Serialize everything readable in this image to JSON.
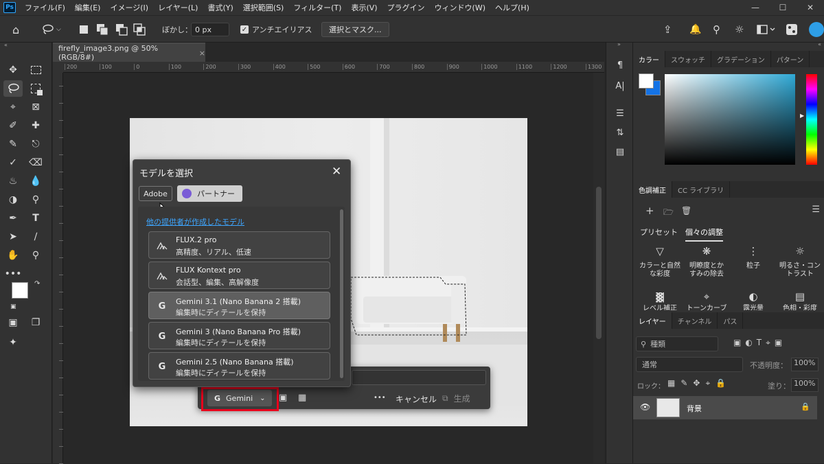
{
  "menubar": {
    "logo": "Ps",
    "items": [
      "ファイル(F)",
      "編集(E)",
      "イメージ(I)",
      "レイヤー(L)",
      "書式(Y)",
      "選択範囲(S)",
      "フィルター(T)",
      "表示(V)",
      "プラグイン",
      "ウィンドウ(W)",
      "ヘルプ(H)"
    ]
  },
  "options": {
    "feather_label": "ぼかし：",
    "feather_value": "0 px",
    "antialias_label": "アンチエイリアス",
    "select_mask": "選択とマスク..."
  },
  "document": {
    "tab_title": "firefly_image3.png @ 50% (RGB/8#)",
    "ruler_ticks": [
      "200",
      "100",
      "0",
      "100",
      "200",
      "300",
      "400",
      "500",
      "600",
      "700",
      "800",
      "900",
      "1000",
      "1100",
      "1200",
      "1300"
    ]
  },
  "dialog": {
    "title": "モデルを選択",
    "tab_adobe": "Adobe",
    "tab_partner": "パートナー",
    "section_link": "他の提供者が作成したモデル",
    "models": [
      {
        "name": "FLUX.2 pro",
        "desc": "高精度、リアル、低速",
        "icon": "flux-icon"
      },
      {
        "name": "FLUX Kontext pro",
        "desc": "会話型、編集、高解像度",
        "icon": "flux-icon"
      },
      {
        "name": "Gemini 3.1 (Nano Banana 2 搭載)",
        "desc": "編集時にディテールを保持",
        "icon": "google-icon",
        "selected": true
      },
      {
        "name": "Gemini 3 (Nano Banana Pro 搭載)",
        "desc": "編集時にディテールを保持",
        "icon": "google-icon"
      },
      {
        "name": "Gemini 2.5 (Nano Banana 搭載)",
        "desc": "編集時にディテールを保持",
        "icon": "google-icon"
      }
    ]
  },
  "genbar": {
    "model_label": "Gemini",
    "more": "•••",
    "cancel": "キャンセル",
    "generate": "生成"
  },
  "color_panel": {
    "tabs": [
      "カラー",
      "スウォッチ",
      "グラデーション",
      "パターン"
    ],
    "fg_color": "#ffffff",
    "bg_color": "#1473e6"
  },
  "adjust_panel": {
    "tabs": [
      "色調補正",
      "CC ライブラリ"
    ],
    "subtabs": [
      "プリセット",
      "個々の調整"
    ],
    "items": [
      {
        "label": "カラーと自然\nな彩度"
      },
      {
        "label": "明瞭度とか\nすみの除去"
      },
      {
        "label": "粒子"
      },
      {
        "label": "明るさ・コン\nトラスト"
      }
    ],
    "row2": [
      "レベル補正",
      "トーンカーブ",
      "露光量",
      "色相・彩度"
    ]
  },
  "layers_panel": {
    "tabs": [
      "レイヤー",
      "チャンネル",
      "パス"
    ],
    "search_placeholder": "種類",
    "blend_mode": "通常",
    "opacity_label": "不透明度：",
    "opacity_value": "100%",
    "lock_label": "ロック：",
    "fill_label": "塗り：",
    "fill_value": "100%",
    "layer_name": "背景"
  }
}
